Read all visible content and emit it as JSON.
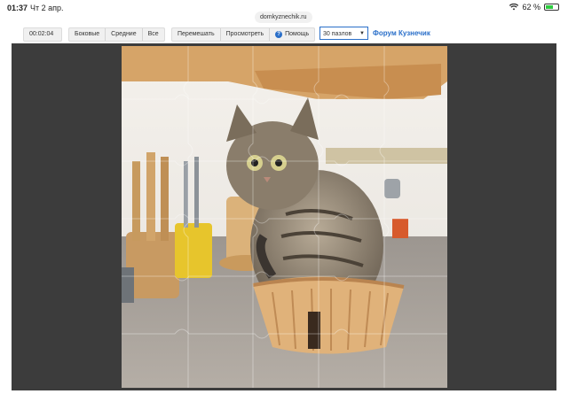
{
  "status": {
    "time": "01:37",
    "date": "Чт 2 апр.",
    "battery": "62 %",
    "battery_level": 0.62
  },
  "url": "domkyznechik.ru",
  "toolbar": {
    "timer": "00:02:04",
    "edges": "Боковые",
    "middle": "Средние",
    "all": "Все",
    "shuffle": "Перемешать",
    "preview": "Просмотреть",
    "help": "Помощь",
    "help_icon": "?"
  },
  "select": {
    "value": "30 пазлов"
  },
  "forum_link": "Форум Кузнечик",
  "colors": {
    "accent": "#2a6fc9",
    "board": "#3c3c3c"
  },
  "icons": {
    "wifi": "wifi-icon",
    "battery": "battery-icon",
    "help": "help-circle-icon",
    "dropdown": "chevron-down-icon"
  }
}
